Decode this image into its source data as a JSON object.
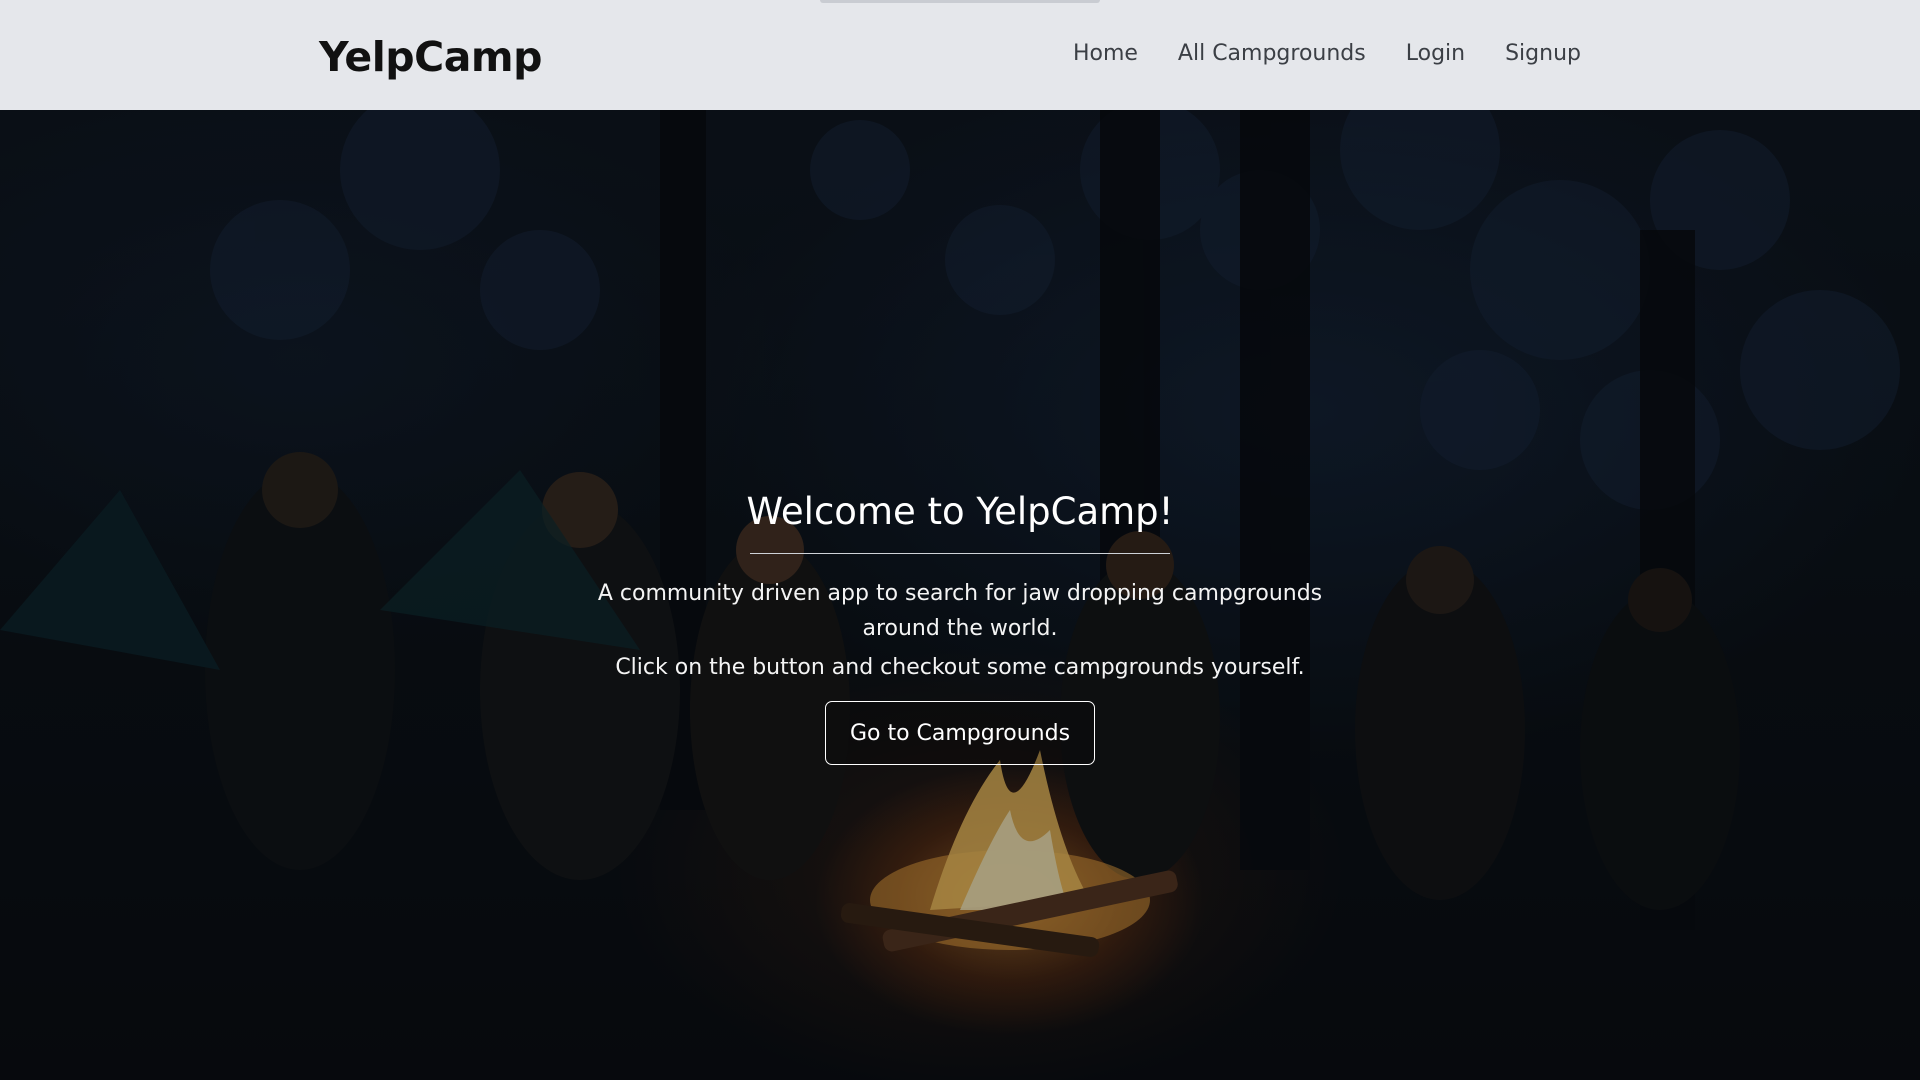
{
  "navbar": {
    "brand": "YelpCamp",
    "links": [
      {
        "label": "Home"
      },
      {
        "label": "All Campgrounds"
      },
      {
        "label": "Login"
      },
      {
        "label": "Signup"
      }
    ]
  },
  "hero": {
    "title": "Welcome to YelpCamp!",
    "lead": "A community driven app to search for jaw dropping campgrounds around the world.",
    "sub": "Click on the button and checkout some campgrounds yourself.",
    "button_label": "Go to Campgrounds",
    "background_image": "campfire-at-night-photo"
  },
  "colors": {
    "navbar_bg": "#e5e7eb",
    "brand_text": "#111111",
    "nav_link_text": "#3b3f45",
    "hero_text": "#ffffff"
  }
}
